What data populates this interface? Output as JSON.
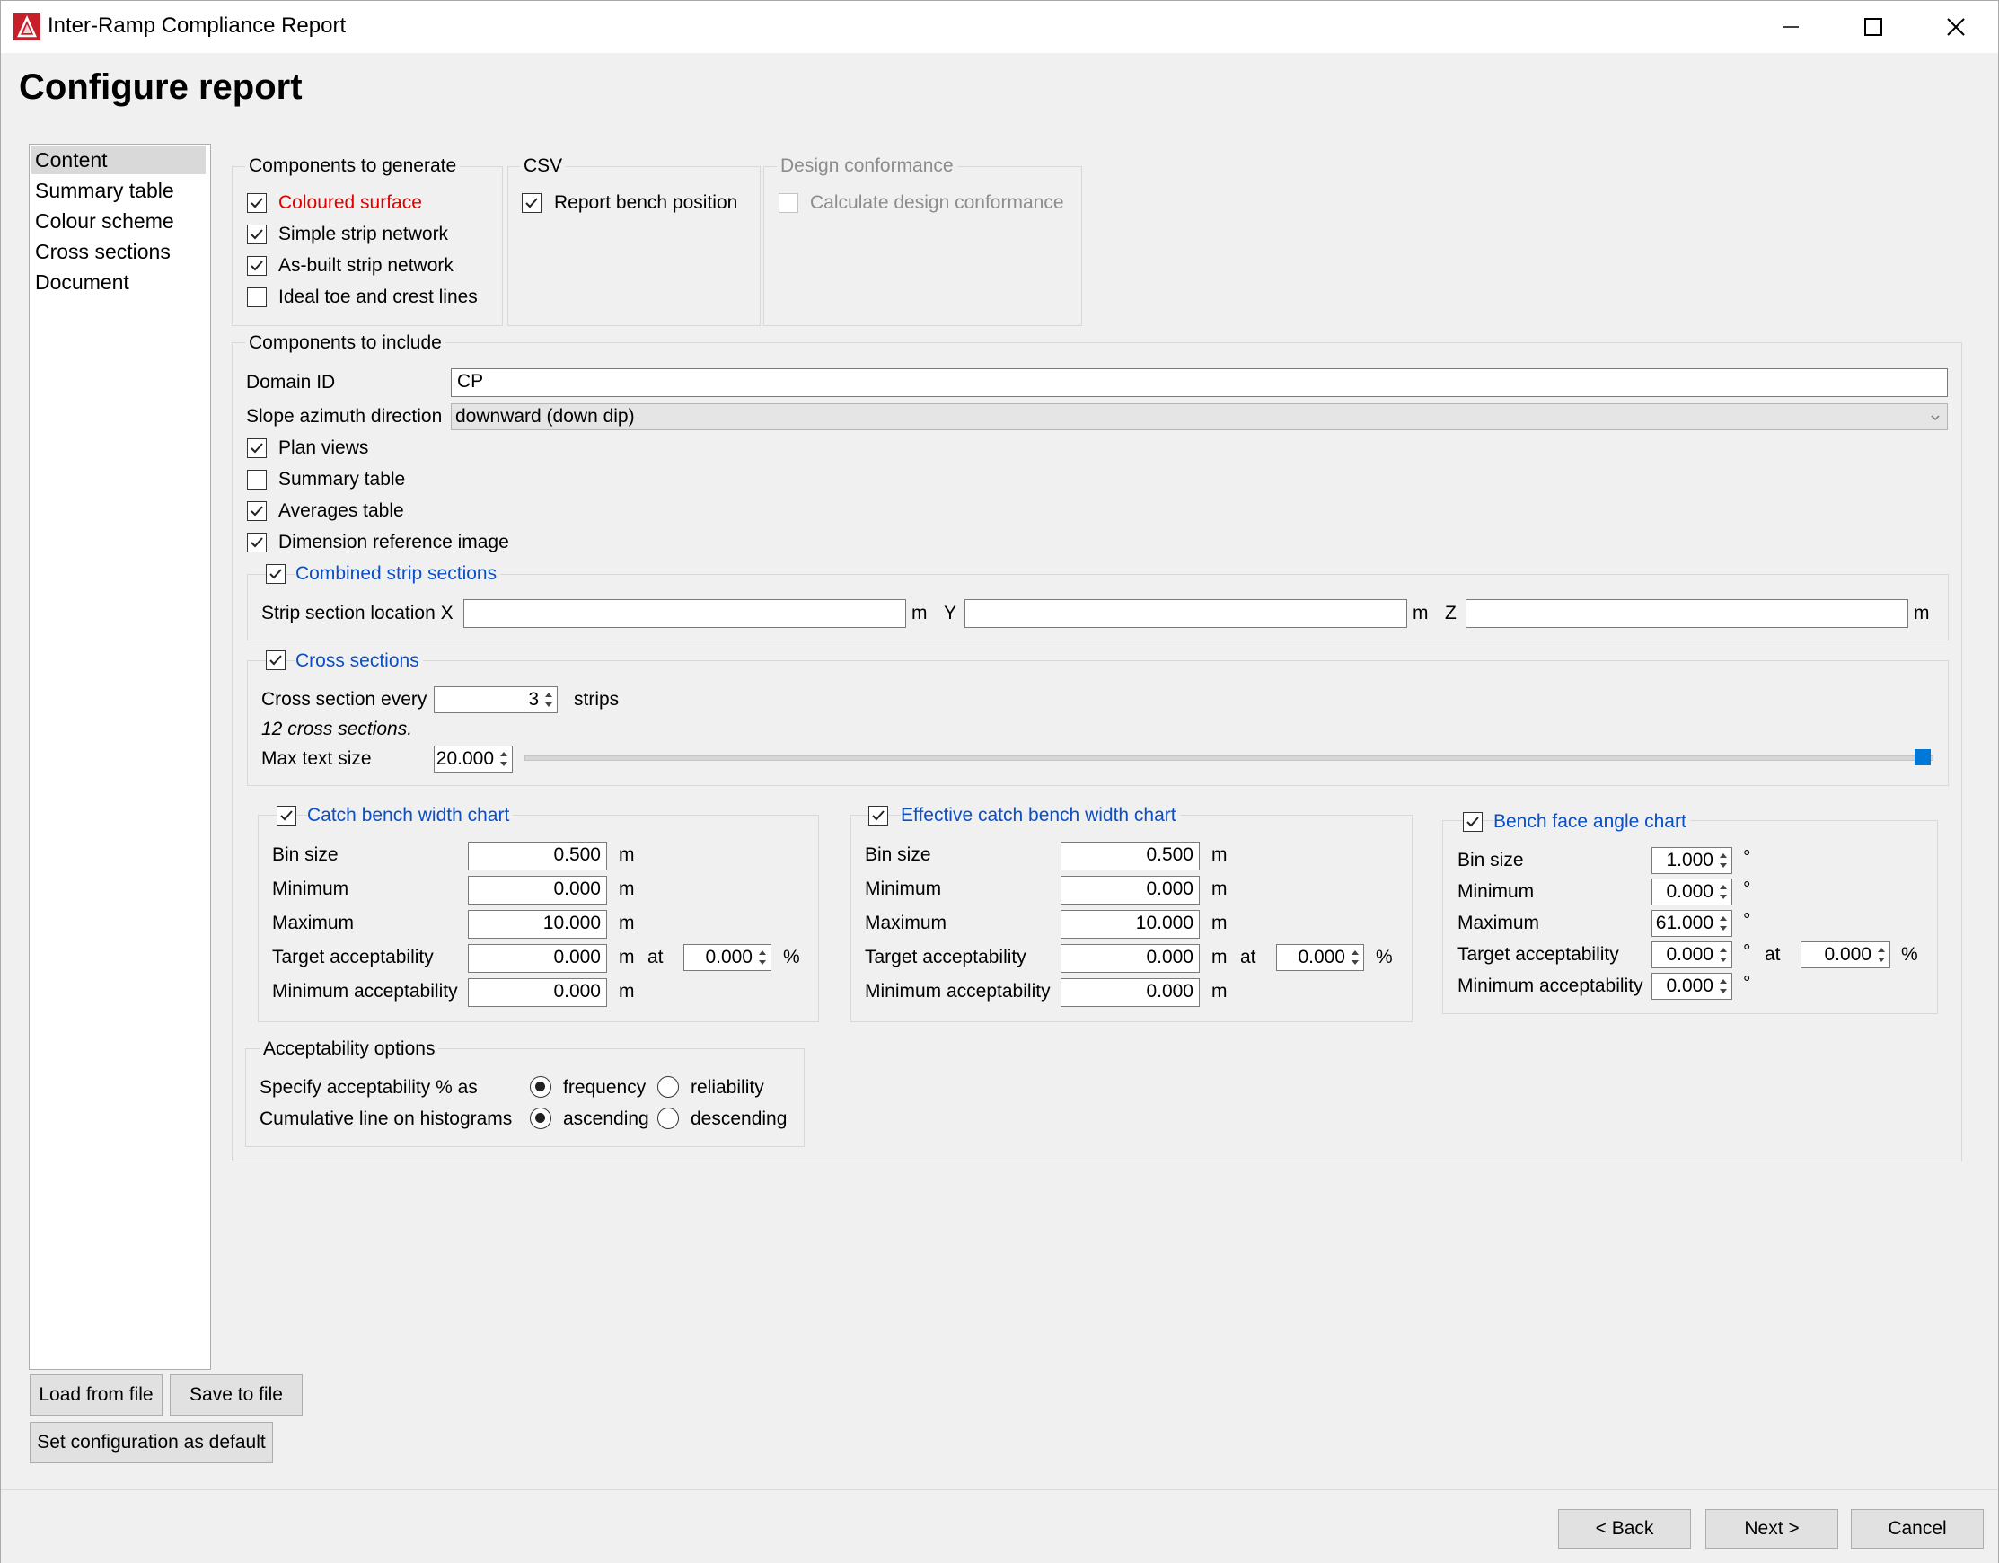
{
  "window": {
    "title": "Inter-Ramp Compliance Report",
    "heading": "Configure report"
  },
  "nav": {
    "items": [
      "Content",
      "Summary table",
      "Colour scheme",
      "Cross sections",
      "Document"
    ]
  },
  "generate": {
    "title": "Components to generate",
    "items": [
      {
        "label": "Coloured surface",
        "checked": true
      },
      {
        "label": "Simple strip network",
        "checked": true
      },
      {
        "label": "As-built strip network",
        "checked": true
      },
      {
        "label": "Ideal toe and crest lines",
        "checked": false
      }
    ]
  },
  "csv": {
    "title": "CSV",
    "report_bench": "Report bench position"
  },
  "design": {
    "title": "Design conformance",
    "calc": "Calculate design conformance"
  },
  "include": {
    "title": "Components to include",
    "domain_label": "Domain ID",
    "domain_value": "CP",
    "azimuth_label": "Slope azimuth direction",
    "azimuth_value": "downward (down dip)",
    "items": [
      {
        "label": "Plan views",
        "checked": true
      },
      {
        "label": "Summary table",
        "checked": false
      },
      {
        "label": "Averages table",
        "checked": true
      },
      {
        "label": "Dimension reference image",
        "checked": true
      }
    ]
  },
  "combined": {
    "title": "Combined strip sections",
    "location_label": "Strip section location X",
    "unit": "m",
    "y": "Y",
    "z": "Z"
  },
  "cross": {
    "title": "Cross sections",
    "every_label": "Cross section every",
    "every_value": "3",
    "every_unit": "strips",
    "count_note": "12 cross sections.",
    "max_text_label": "Max text size",
    "max_text_value": "20.000"
  },
  "labels": {
    "bin": "Bin size",
    "min": "Minimum",
    "max": "Maximum",
    "target": "Target acceptability",
    "min_acc": "Minimum acceptability",
    "m": "m",
    "at": "at",
    "pct": "%",
    "deg": "°"
  },
  "catch": {
    "title": "Catch bench width chart",
    "bin": "0.500",
    "min": "0.000",
    "max": "10.000",
    "target": "0.000",
    "target_pct": "0.000",
    "min_acc": "0.000"
  },
  "effective": {
    "title": "Effective catch bench width chart",
    "bin": "0.500",
    "min": "0.000",
    "max": "10.000",
    "target": "0.000",
    "target_pct": "0.000",
    "min_acc": "0.000"
  },
  "bfa": {
    "title": "Bench face angle chart",
    "bin": "1.000",
    "min": "0.000",
    "max": "61.000",
    "target": "0.000",
    "target_pct": "0.000",
    "min_acc": "0.000"
  },
  "accept": {
    "title": "Acceptability options",
    "specify_label": "Specify acceptability % as",
    "frequency": "frequency",
    "reliability": "reliability",
    "cumulative_label": "Cumulative line on histograms",
    "ascending": "ascending",
    "descending": "descending"
  },
  "buttons": {
    "load": "Load from file",
    "save": "Save to file",
    "set_default": "Set configuration as default",
    "back": "< Back",
    "next": "Next >",
    "cancel": "Cancel"
  }
}
